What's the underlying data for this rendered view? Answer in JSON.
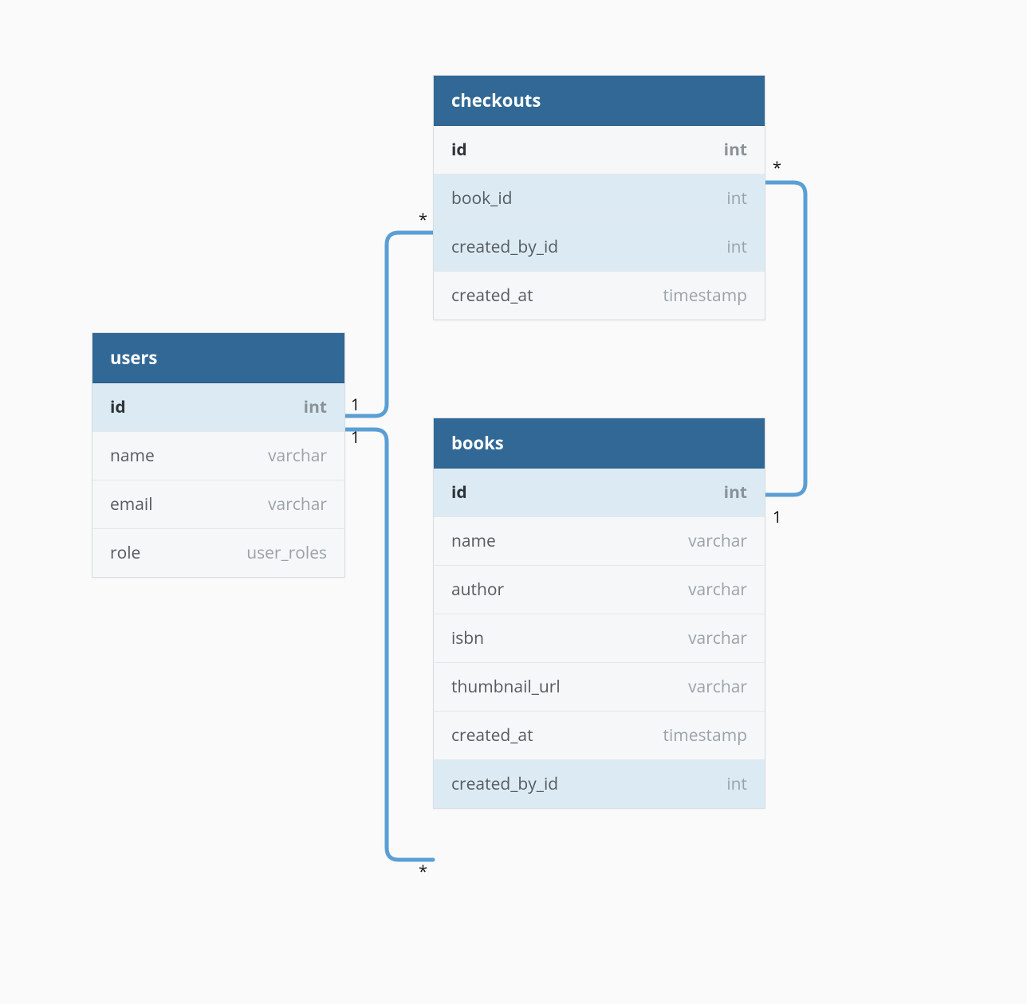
{
  "entities": {
    "users": {
      "title": "users",
      "columns": [
        {
          "name": "id",
          "type": "int",
          "bold": true,
          "highlight": true
        },
        {
          "name": "name",
          "type": "varchar",
          "bold": false,
          "highlight": false
        },
        {
          "name": "email",
          "type": "varchar",
          "bold": false,
          "highlight": false
        },
        {
          "name": "role",
          "type": "user_roles",
          "bold": false,
          "highlight": false
        }
      ]
    },
    "checkouts": {
      "title": "checkouts",
      "columns": [
        {
          "name": "id",
          "type": "int",
          "bold": true,
          "highlight": false
        },
        {
          "name": "book_id",
          "type": "int",
          "bold": false,
          "highlight": true
        },
        {
          "name": "created_by_id",
          "type": "int",
          "bold": false,
          "highlight": true
        },
        {
          "name": "created_at",
          "type": "timestamp",
          "bold": false,
          "highlight": false
        }
      ]
    },
    "books": {
      "title": "books",
      "columns": [
        {
          "name": "id",
          "type": "int",
          "bold": true,
          "highlight": true
        },
        {
          "name": "name",
          "type": "varchar",
          "bold": false,
          "highlight": false
        },
        {
          "name": "author",
          "type": "varchar",
          "bold": false,
          "highlight": false
        },
        {
          "name": "isbn",
          "type": "varchar",
          "bold": false,
          "highlight": false
        },
        {
          "name": "thumbnail_url",
          "type": "varchar",
          "bold": false,
          "highlight": false
        },
        {
          "name": "created_at",
          "type": "timestamp",
          "bold": false,
          "highlight": false
        },
        {
          "name": "created_by_id",
          "type": "int",
          "bold": false,
          "highlight": true
        }
      ]
    }
  },
  "relationships": [
    {
      "from": "users.id",
      "to": "checkouts.created_by_id",
      "from_card": "1",
      "to_card": "*"
    },
    {
      "from": "users.id",
      "to": "books.created_by_id",
      "from_card": "1",
      "to_card": "*"
    },
    {
      "from": "books.id",
      "to": "checkouts.book_id",
      "from_card": "1",
      "to_card": "*"
    }
  ],
  "labels": {
    "star": "*",
    "one": "1"
  }
}
